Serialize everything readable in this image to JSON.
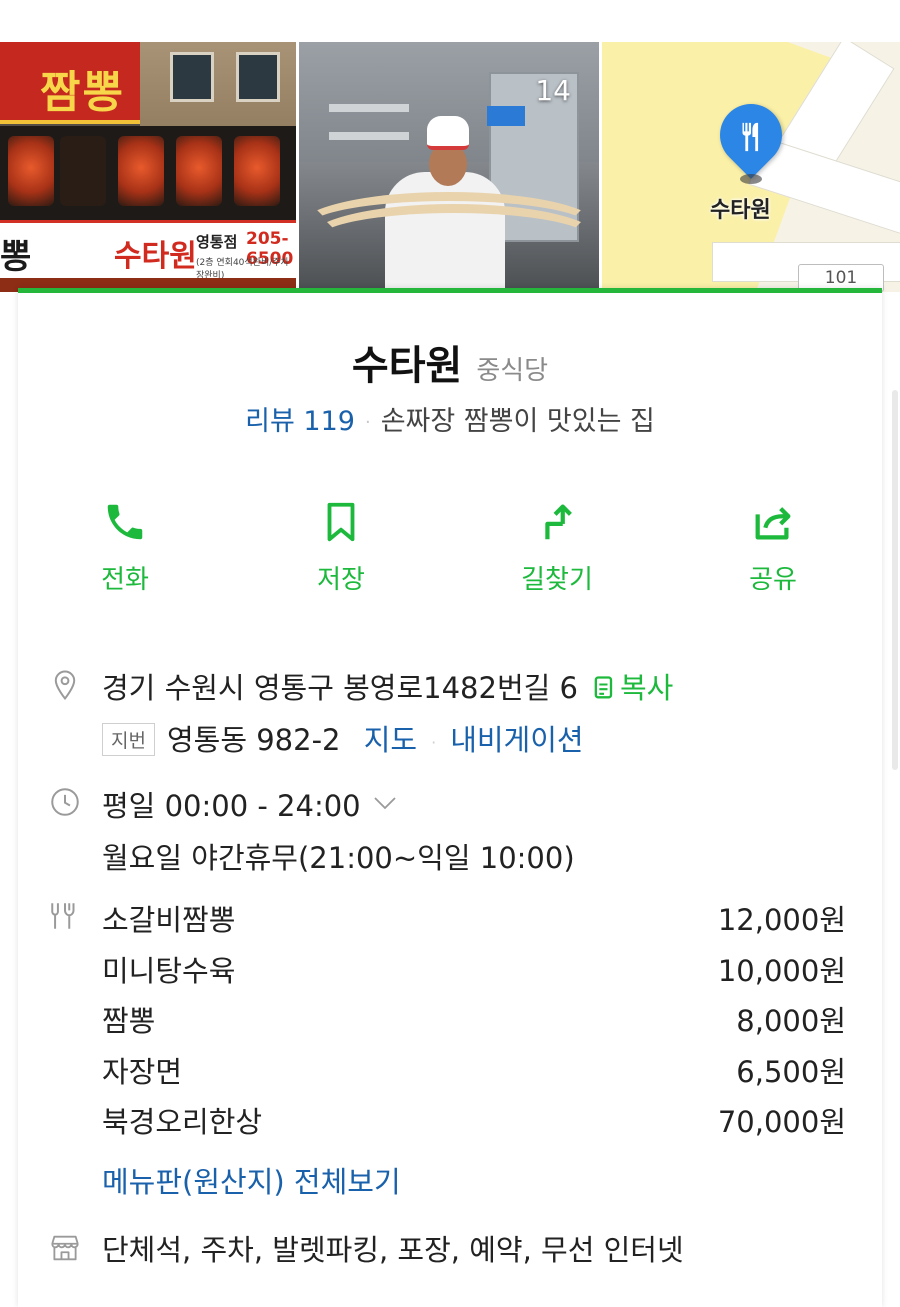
{
  "photos": {
    "storefront": {
      "sign_top": "짬뽕",
      "banner_left": "뽕",
      "banner_main": "수타원",
      "banner_branch": "영통점",
      "banner_phone": "205-6500",
      "banner_small": "(2층 연회40석완비/주차장완비)"
    },
    "kitchen": {
      "photo_count": "14"
    },
    "map": {
      "pin_label": "수타원",
      "road_number": "101",
      "pin_icon": "fork-knife-icon"
    }
  },
  "place": {
    "name": "수타원",
    "category": "중식당",
    "review_label": "리뷰 119",
    "tagline": "손짜장 짬뽕이 맛있는 집"
  },
  "actions": [
    {
      "label": "전화",
      "icon": "phone-icon"
    },
    {
      "label": "저장",
      "icon": "bookmark-icon"
    },
    {
      "label": "길찾기",
      "icon": "directions-icon"
    },
    {
      "label": "공유",
      "icon": "share-icon"
    }
  ],
  "address": {
    "road": "경기 수원시 영통구 봉영로1482번길 6",
    "copy_label": "복사",
    "jibun_tag": "지번",
    "jibun": "영통동 982-2",
    "map_link": "지도",
    "navi_link": "내비게이션"
  },
  "hours": {
    "summary": "평일 00:00 - 24:00",
    "note": "월요일 야간휴무(21:00~익일 10:00)"
  },
  "menu": {
    "items": [
      {
        "name": "소갈비짬뽕",
        "price": "12,000원"
      },
      {
        "name": "미니탕수육",
        "price": "10,000원"
      },
      {
        "name": "짬뽕",
        "price": "8,000원"
      },
      {
        "name": "자장면",
        "price": "6,500원"
      },
      {
        "name": "북경오리한상",
        "price": "70,000원"
      }
    ],
    "more_link": "메뉴판(원산지) 전체보기"
  },
  "amenities": "단체석, 주차, 발렛파킹, 포장, 예약, 무선 인터넷",
  "colors": {
    "accent_green": "#1db93c",
    "link_blue": "#1a61ab",
    "border_green": "#25b63c"
  }
}
